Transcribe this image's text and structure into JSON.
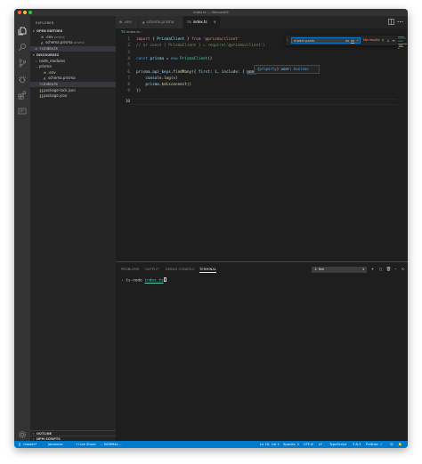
{
  "window": {
    "title": "index.ts — discourse2",
    "traffic_lights": {
      "close": "#ff5f57",
      "minimize": "#febc2e",
      "maximize": "#28c840"
    }
  },
  "sidebar": {
    "title": "EXPLORER",
    "open_editors": {
      "label": "OPEN EDITORS",
      "items": [
        {
          "name": ".env",
          "detail": "prisma",
          "icon": "settings-file-icon"
        },
        {
          "name": "schema.prisma",
          "detail": "prisma",
          "icon": "prisma-file-icon"
        },
        {
          "name": "index.ts",
          "detail": "",
          "icon": "typescript-file-icon",
          "badge": "TS",
          "selected": true
        }
      ]
    },
    "project": {
      "label": "DISCOURSE2",
      "items": [
        {
          "name": "node_modules",
          "type": "folder",
          "expanded": false
        },
        {
          "name": "prisma",
          "type": "folder",
          "expanded": true
        },
        {
          "name": ".env",
          "type": "file",
          "indent": 2
        },
        {
          "name": "schema.prisma",
          "type": "file",
          "indent": 2
        },
        {
          "name": "index.ts",
          "type": "file",
          "badge": "TS"
        },
        {
          "name": "package-lock.json",
          "type": "file",
          "badge": "{}"
        },
        {
          "name": "package.json",
          "type": "file",
          "badge": "{}"
        }
      ]
    },
    "outline_label": "OUTLINE",
    "npm_scripts_label": "NPM SCRIPTS"
  },
  "tabs": [
    {
      "label": ".env",
      "icon_text": "⚙",
      "active": false
    },
    {
      "label": "schema.prisma",
      "icon_text": "◭",
      "active": false
    },
    {
      "label": "index.ts",
      "icon_text": "TS",
      "active": true
    }
  ],
  "breadcrumb": {
    "badge": "TS",
    "file": "index.ts",
    "separator": "›"
  },
  "editor": {
    "current_line": 10,
    "line_numbers": [
      "1",
      "2",
      "3",
      "4",
      "5",
      "6",
      "7",
      "8",
      "9",
      "10"
    ],
    "code": {
      "l1": {
        "import": "import",
        "open": " { ",
        "cls": "PrismaClient",
        "close": " } ",
        "from": "from",
        "path": " '@prisma/client'"
      },
      "l2": "// or const { PrismaClient } = require('@prisma/client')",
      "l4": {
        "const": "const",
        "var": " prisma",
        "eq": " = ",
        "new": "new",
        "cls": " PrismaClient",
        "rest": "()"
      },
      "l6": {
        "obj": "prisma",
        "dot1": ".",
        "model": "api_keys",
        "dot2": ".",
        "fn": "findMany",
        "open": "({ ",
        "first": "first",
        "colon1": ": ",
        "num": "1",
        "comma": ", ",
        "include": "include",
        "colon2": ": { ",
        "user": "user",
        "colon3": ": ",
        "bool": "true",
        "close": " } }).",
        "then": "then",
        "arrow_open": "(",
        "x": "x",
        "arrow": " => {"
      },
      "l7": {
        "indent": "    ",
        "obj": "console",
        "dot": ".",
        "fn": "log",
        "open": "(",
        "x": "x",
        "close": ")"
      },
      "l8": {
        "indent": "    ",
        "obj": "prisma",
        "dot": ".",
        "fn": "$disconnect",
        "close": "()"
      },
      "l9": "})"
    },
    "hover_tooltip": {
      "paren_open": "(",
      "kind": "property",
      "paren_close": ")",
      "name": " user",
      "colon": ": ",
      "type": "boolean"
    },
    "find": {
      "query": "model posts",
      "opt_case": "Aa",
      "opt_word": "Ab",
      "opt_regex": ".*",
      "status": "No results",
      "prev": "↑",
      "next": "↓",
      "selection": "≡",
      "close": "×"
    }
  },
  "panel": {
    "tabs": [
      "PROBLEMS",
      "OUTPUT",
      "DEBUG CONSOLE",
      "TERMINAL"
    ],
    "active_tab": "TERMINAL",
    "terminal_select": "1: fish",
    "terminal_lines": {
      "prompt": "›",
      "command": " ts-node ",
      "arg": "index.ts"
    }
  },
  "status_bar": {
    "branch": "master*",
    "user": "Johannes",
    "live_share": "Live Share",
    "vim_mode": "-- NORMAL --",
    "position": "Ln 10, Col 1",
    "spaces": "Spaces: 2",
    "encoding": "UTF-8",
    "eol": "LF",
    "language": "TypeScript",
    "version": "3.6.3",
    "prettier": "Prettier:",
    "prettier_state": "✓"
  },
  "colors": {
    "status_bar": "#007acc",
    "editor_bg": "#1e1e1e",
    "sidebar_bg": "#252526",
    "activity_bar": "#333333",
    "typescript_badge": "#519aba"
  }
}
